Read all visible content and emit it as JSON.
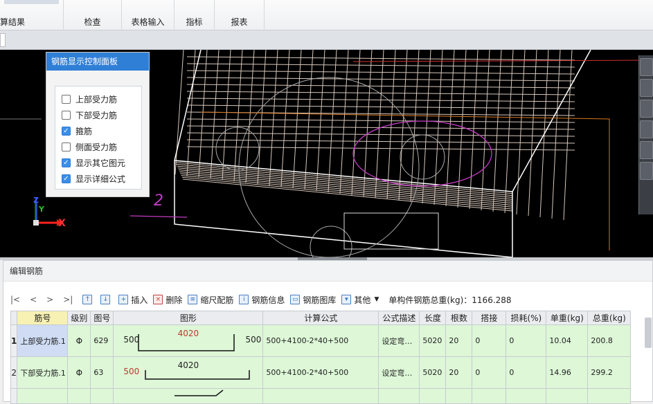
{
  "ribbon": {
    "groups": [
      "算结果",
      "检查",
      "表格输入",
      "指标",
      "报表"
    ]
  },
  "panel": {
    "title": "钢筋显示控制面板",
    "options": [
      {
        "label": "上部受力筋",
        "checked": false
      },
      {
        "label": "下部受力筋",
        "checked": false
      },
      {
        "label": "箍筋",
        "checked": true
      },
      {
        "label": "侧面受力筋",
        "checked": false
      },
      {
        "label": "显示其它图元",
        "checked": true
      },
      {
        "label": "显示详细公式",
        "checked": true
      }
    ]
  },
  "viewport": {
    "axis_x": "X",
    "axis_y": "Y",
    "axis_z": "Z",
    "annotation": "2"
  },
  "edit": {
    "title": "编辑钢筋",
    "nav": [
      "|<",
      "<",
      ">",
      ">|"
    ],
    "toolbar": {
      "insert": "插入",
      "delete": "删除",
      "scale": "缩尺配筋",
      "info": "钢筋信息",
      "library": "钢筋图库",
      "other": "其他",
      "weight_label": "单构件钢筋总重(kg)：1166.288"
    },
    "columns": [
      "筋号",
      "级别",
      "图号",
      "图形",
      "计算公式",
      "公式描述",
      "长度",
      "根数",
      "搭接",
      "损耗(%)",
      "单重(kg)",
      "总重(kg)"
    ],
    "rows": [
      {
        "index": "1",
        "name": "上部受力筋.1",
        "grade": "Φ",
        "fig": "629",
        "shape_left": "500",
        "shape_mid": "4020",
        "shape_right": "500",
        "formula": "500+4100-2*40+500",
        "desc": "设定弯…",
        "length": "5020",
        "count": "20",
        "lap": "0",
        "loss": "0",
        "unit": "10.04",
        "total": "200.8"
      },
      {
        "index": "2",
        "name": "下部受力筋.1",
        "grade": "Φ",
        "fig": "63",
        "shape_left": "500",
        "shape_mid": "4020",
        "shape_right": "",
        "formula": "500+4100-2*40+500",
        "desc": "设定弯…",
        "length": "5020",
        "count": "20",
        "lap": "0",
        "loss": "0",
        "unit": "14.96",
        "total": "299.2"
      }
    ]
  },
  "colors": {
    "panel_title": "#2f7fd6",
    "row_bg": "#ddf7d7",
    "selected": "#cfdcf4"
  }
}
